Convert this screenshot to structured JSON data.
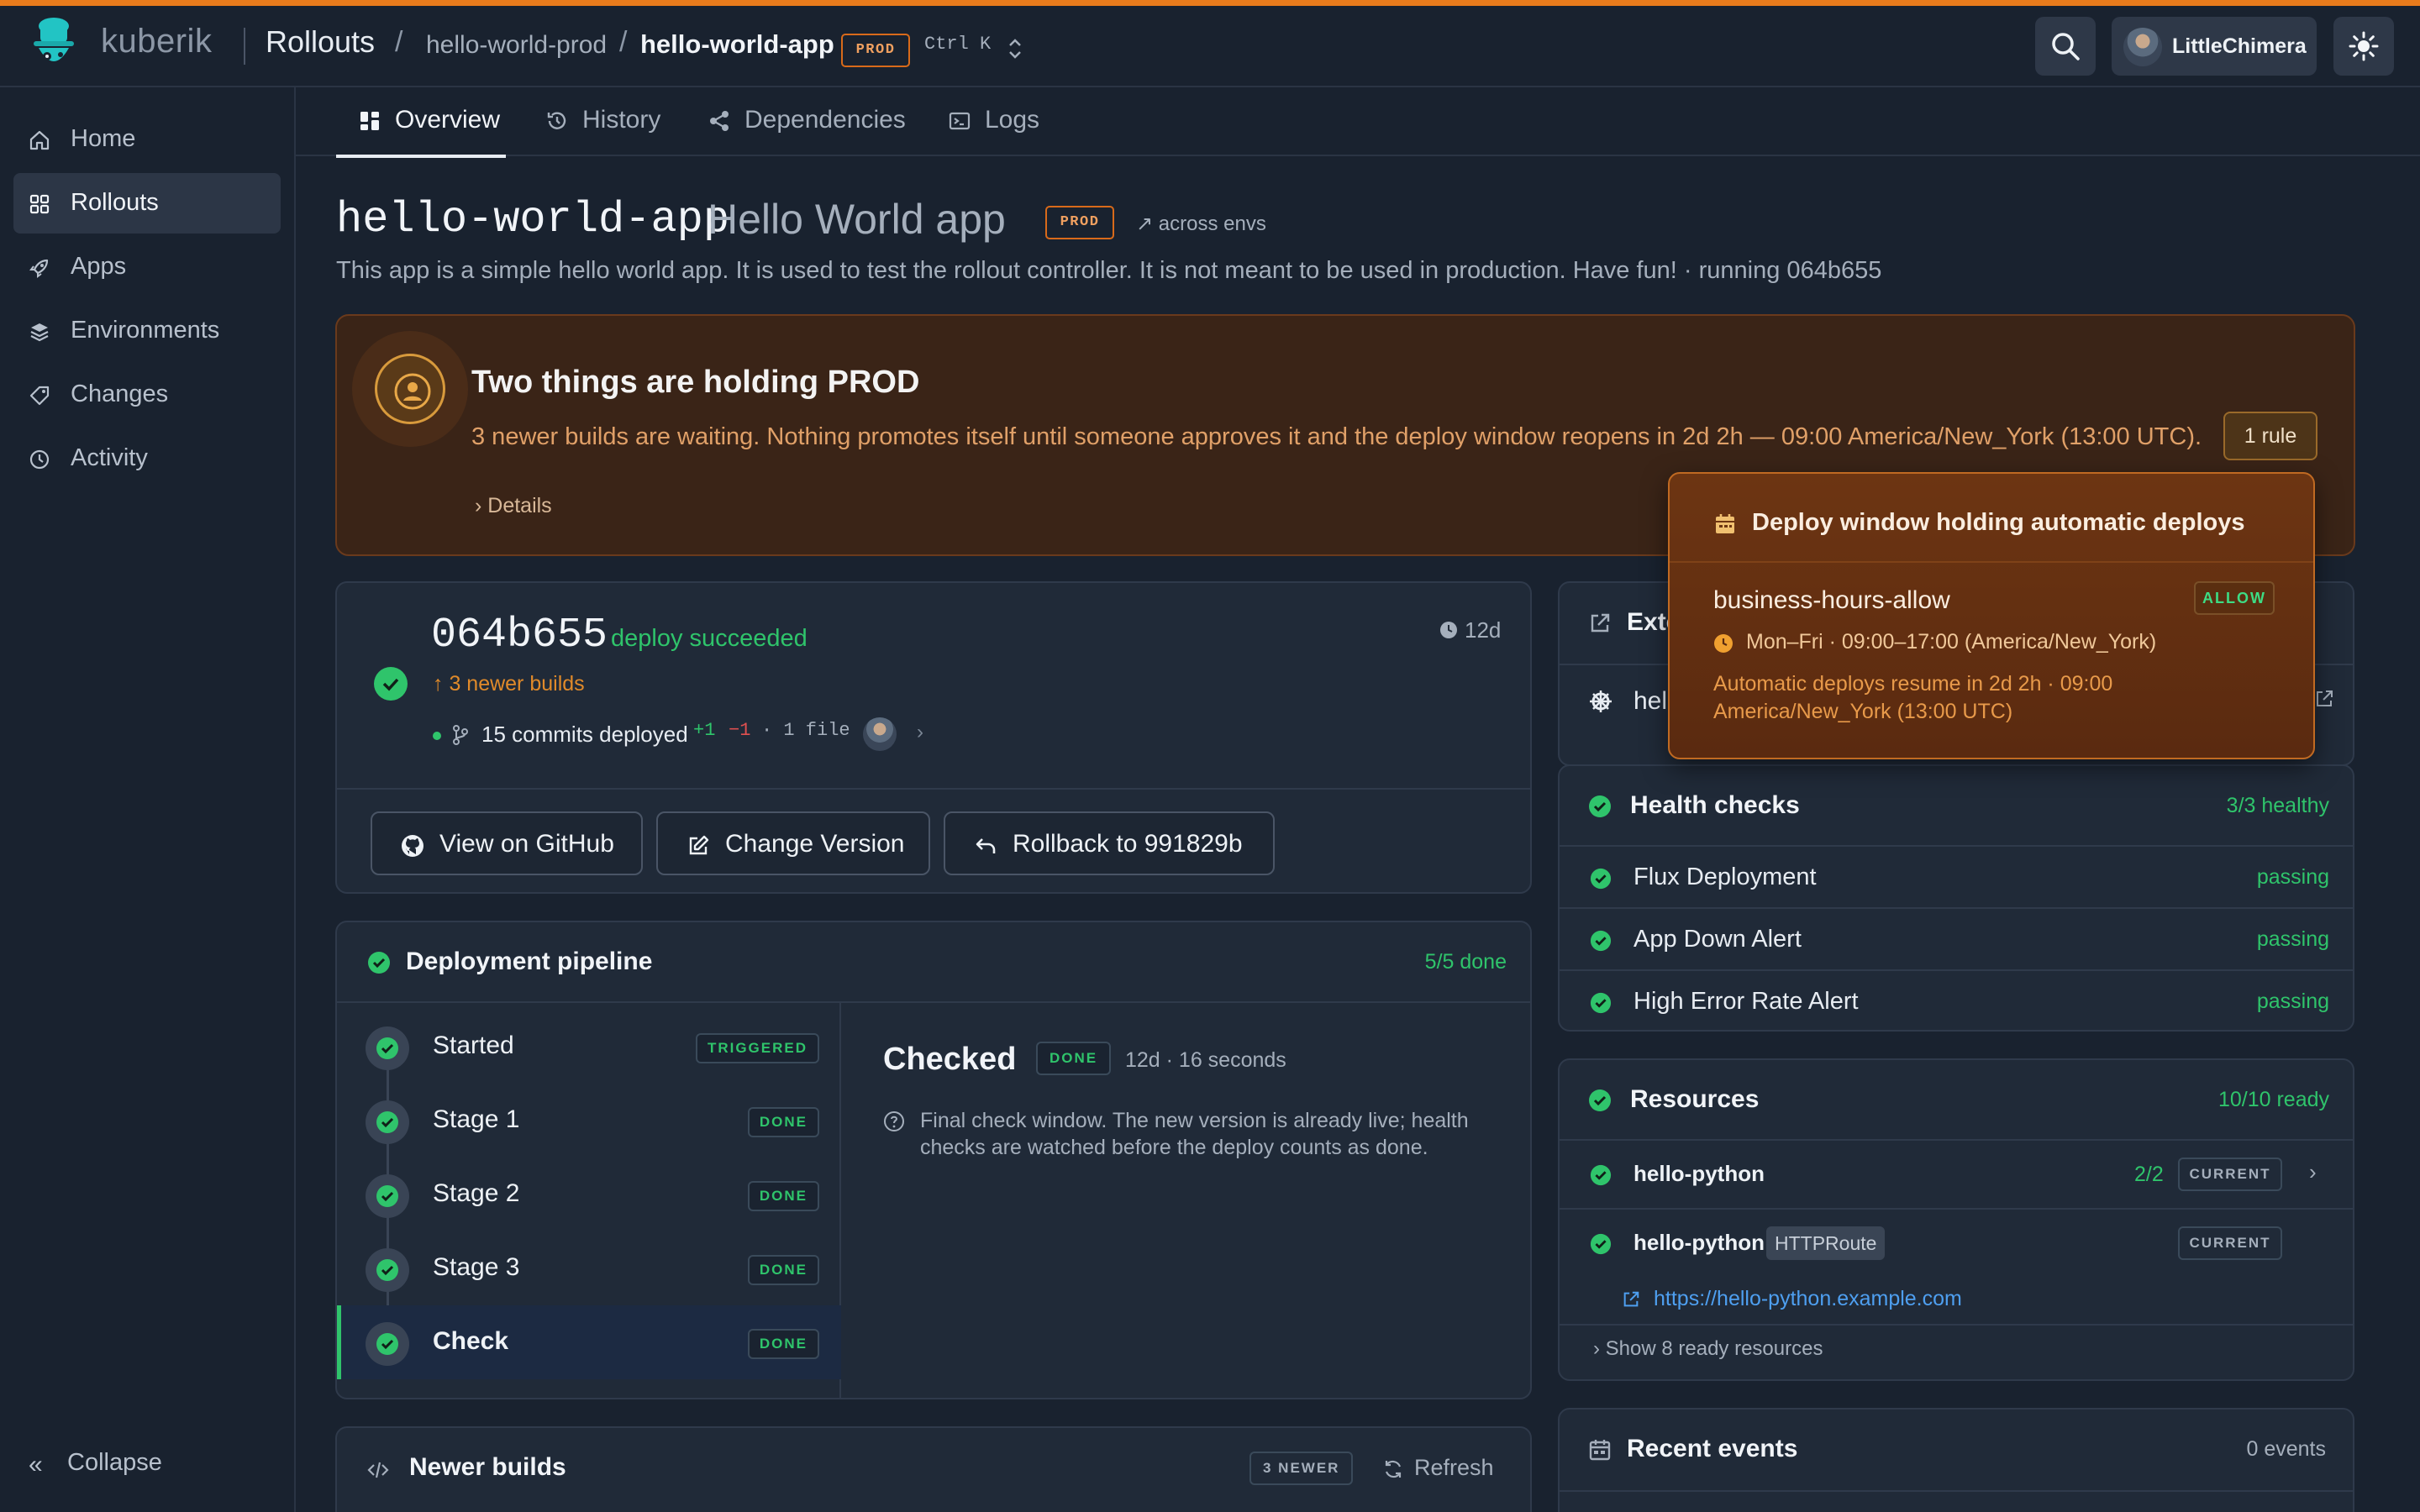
{
  "colors": {
    "accent": "#e87b1c",
    "background": "#19222f",
    "card": "#202a38",
    "success": "#2fc46b",
    "warning": "#e0a068",
    "link": "#4e9ff0"
  },
  "brand": {
    "name": "kuberik",
    "logo_icon": "bowler-hat-icon"
  },
  "breadcrumb": {
    "section": "Rollouts",
    "separator": "/",
    "environment": "hello-world-prod",
    "app": "hello-world-app",
    "badge": "PROD",
    "shortcut": "Ctrl K"
  },
  "user": {
    "name": "LittleChimera"
  },
  "sidebar": {
    "items": [
      {
        "label": "Home",
        "icon": "home-icon",
        "active": false
      },
      {
        "label": "Rollouts",
        "icon": "grid-icon",
        "active": true
      },
      {
        "label": "Apps",
        "icon": "rocket-icon",
        "active": false
      },
      {
        "label": "Environments",
        "icon": "layers-icon",
        "active": false
      },
      {
        "label": "Changes",
        "icon": "tag-icon",
        "active": false
      },
      {
        "label": "Activity",
        "icon": "clock-icon",
        "active": false
      }
    ],
    "collapse_icon": "«",
    "collapse_label": "Collapse"
  },
  "tabs": [
    {
      "label": "Overview",
      "icon": "dashboard-icon",
      "active": true
    },
    {
      "label": "History",
      "icon": "history-icon",
      "active": false
    },
    {
      "label": "Dependencies",
      "icon": "share-icon",
      "active": false
    },
    {
      "label": "Logs",
      "icon": "terminal-icon",
      "active": false
    }
  ],
  "header": {
    "app_id": "hello-world-app",
    "app_name": "Hello World app",
    "badge": "PROD",
    "across_envs": "↗ across envs",
    "description": "This app is a simple hello world app. It is used to test the rollout controller. It is not meant to be used in production. Have fun! · running 064b655"
  },
  "holding": {
    "title": "Two things are holding PROD",
    "body": "3 newer builds are waiting. Nothing promotes itself until someone approves it and the deploy window reopens in 2d 2h — 09:00 America/New_York (13:00 UTC).",
    "details": "›  Details",
    "rule_button": "1 rule"
  },
  "popover": {
    "title": "Deploy window holding automatic deploys",
    "rule_name": "business-hours-allow",
    "rule_badge": "ALLOW",
    "schedule": "Mon–Fri · 09:00–17:00 (America/New_York)",
    "resume": "Automatic deploys resume in 2d 2h · 09:00 America/New_York (13:00 UTC)"
  },
  "version": {
    "sha": "064b655",
    "status": "deploy succeeded",
    "age": "12d",
    "newer_builds": "↑  3 newer builds",
    "commits": "15 commits deployed",
    "additions": "+1",
    "deletions": "−1",
    "files": "· 1 file",
    "chevron": "›",
    "buttons": {
      "github": "View on GitHub",
      "change": "Change Version",
      "rollback": "Rollback to 991829b"
    }
  },
  "pipeline": {
    "title": "Deployment pipeline",
    "count": "5/5 done",
    "stages": [
      {
        "label": "Started",
        "badge": "TRIGGERED"
      },
      {
        "label": "Stage 1",
        "badge": "DONE"
      },
      {
        "label": "Stage 2",
        "badge": "DONE"
      },
      {
        "label": "Stage 3",
        "badge": "DONE"
      },
      {
        "label": "Check",
        "badge": "DONE"
      }
    ],
    "detail": {
      "title": "Checked",
      "badge": "DONE",
      "meta": "12d · 16 seconds",
      "note": "Final check window. The new version is already live; health checks are watched before the deploy counts as done."
    }
  },
  "newer_builds": {
    "title": "Newer builds",
    "badge": "3 NEWER",
    "refresh": "Refresh"
  },
  "external": {
    "title": "Exte",
    "row": "hell"
  },
  "health": {
    "title": "Health checks",
    "count": "3/3 healthy",
    "checks": [
      {
        "label": "Flux Deployment",
        "status": "passing"
      },
      {
        "label": "App Down Alert",
        "status": "passing"
      },
      {
        "label": "High Error Rate Alert",
        "status": "passing"
      }
    ]
  },
  "resources": {
    "title": "Resources",
    "count": "10/10 ready",
    "rows": [
      {
        "name": "hello-python",
        "ready": "2/2",
        "badge": "CURRENT",
        "chevron": "›"
      },
      {
        "name": "hello-python",
        "kind": "HTTPRoute",
        "badge": "CURRENT"
      }
    ],
    "url": "https://hello-python.example.com",
    "show_more": "›   Show 8 ready resources"
  },
  "events": {
    "title": "Recent events",
    "count": "0 events"
  }
}
